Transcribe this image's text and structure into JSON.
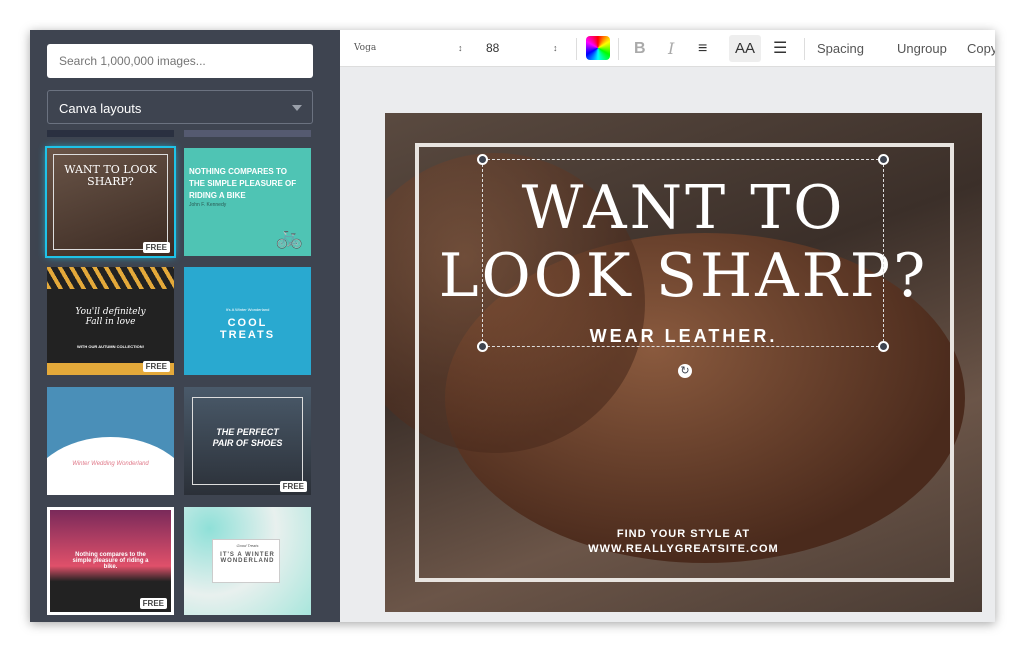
{
  "sidebar": {
    "search_placeholder": "Search 1,000,000 images...",
    "layout_select": "Canva layouts",
    "thumbnails": [
      {
        "title": "WANT TO LOOK SHARP?",
        "badge": "FREE",
        "selected": true
      },
      {
        "title": "NOTHING COMPARES TO THE SIMPLE PLEASURE OF RIDING A BIKE",
        "author": "John F. Kennedy"
      },
      {
        "title": "You'll definitely Fall in love",
        "subtitle": "WITH OUR AUTUMN COLLECTION!",
        "badge": "FREE"
      },
      {
        "title": "COOL TREATS",
        "subtitle": "It's A Winter Wonderland"
      },
      {
        "title": "Winter Wedding Wonderland"
      },
      {
        "title": "THE PERFECT PAIR OF SHOES",
        "badge": "FREE"
      },
      {
        "title": "Nothing compares to the simple pleasure of riding a bike.",
        "badge": "FREE"
      },
      {
        "title": "IT'S A WINTER WONDERLAND",
        "subtitle": "Good Treats"
      }
    ]
  },
  "toolbar": {
    "font": "Voga",
    "size": "88",
    "bold": "B",
    "italic": "I",
    "case": "AA",
    "spacing": "Spacing",
    "ungroup": "Ungroup",
    "copy": "Copy"
  },
  "design": {
    "headline_1": "WANT TO",
    "headline_2": "LOOK SHARP?",
    "subhead": "WEAR LEATHER.",
    "footer_1": "FIND YOUR STYLE AT",
    "footer_2": "WWW.REALLYGREATSITE.COM"
  },
  "colors": {
    "sidebar": "#3e4450",
    "selected_glow": "#1fc3e8",
    "canvas_bg": "#ebecee"
  }
}
